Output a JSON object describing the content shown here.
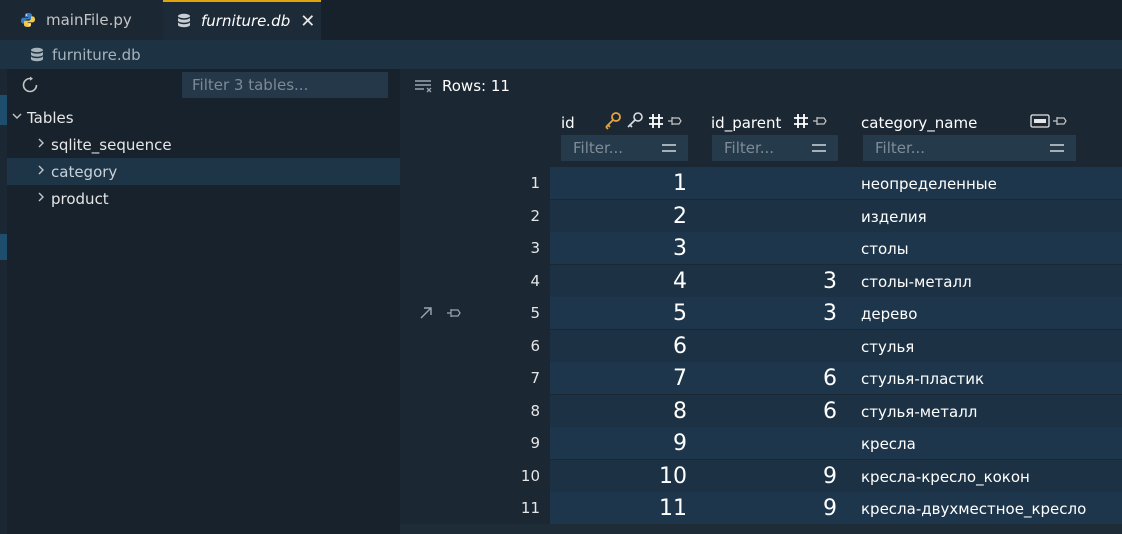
{
  "tabs": [
    {
      "label": "mainFile.py",
      "icon": "python-icon"
    },
    {
      "label": "furniture.db",
      "icon": "database-icon",
      "close": "✕"
    }
  ],
  "breadcrumb": {
    "label": "furniture.db",
    "icon": "database-icon"
  },
  "sidebar": {
    "filter_placeholder": "Filter 3 tables...",
    "root_label": "Tables",
    "items": [
      {
        "label": "sqlite_sequence"
      },
      {
        "label": "category"
      },
      {
        "label": "product"
      }
    ]
  },
  "main": {
    "rows_label": "Rows: 11",
    "filter_placeholder": "Filter...",
    "columns": [
      {
        "name": "id"
      },
      {
        "name": "id_parent"
      },
      {
        "name": "category_name"
      }
    ],
    "rows": [
      {
        "num": "1",
        "id": "1",
        "id_parent": "",
        "category_name": "неопределенные"
      },
      {
        "num": "2",
        "id": "2",
        "id_parent": "",
        "category_name": "изделия"
      },
      {
        "num": "3",
        "id": "3",
        "id_parent": "",
        "category_name": "столы"
      },
      {
        "num": "4",
        "id": "4",
        "id_parent": "3",
        "category_name": "столы-металл"
      },
      {
        "num": "5",
        "id": "5",
        "id_parent": "3",
        "category_name": "дерево"
      },
      {
        "num": "6",
        "id": "6",
        "id_parent": "",
        "category_name": "стулья"
      },
      {
        "num": "7",
        "id": "7",
        "id_parent": "6",
        "category_name": "стулья-пластик"
      },
      {
        "num": "8",
        "id": "8",
        "id_parent": "6",
        "category_name": "стулья-металл"
      },
      {
        "num": "9",
        "id": "9",
        "id_parent": "",
        "category_name": "кресла"
      },
      {
        "num": "10",
        "id": "10",
        "id_parent": "9",
        "category_name": "кресла-кресло_кокон"
      },
      {
        "num": "11",
        "id": "11",
        "id_parent": "9",
        "category_name": "кресла-двухместное_кресло"
      }
    ]
  },
  "colors": {
    "accent": "#e2a40d",
    "key_icon": "#e8a33d",
    "python_blue": "#3b7bbf",
    "python_yellow": "#f2c94c"
  }
}
